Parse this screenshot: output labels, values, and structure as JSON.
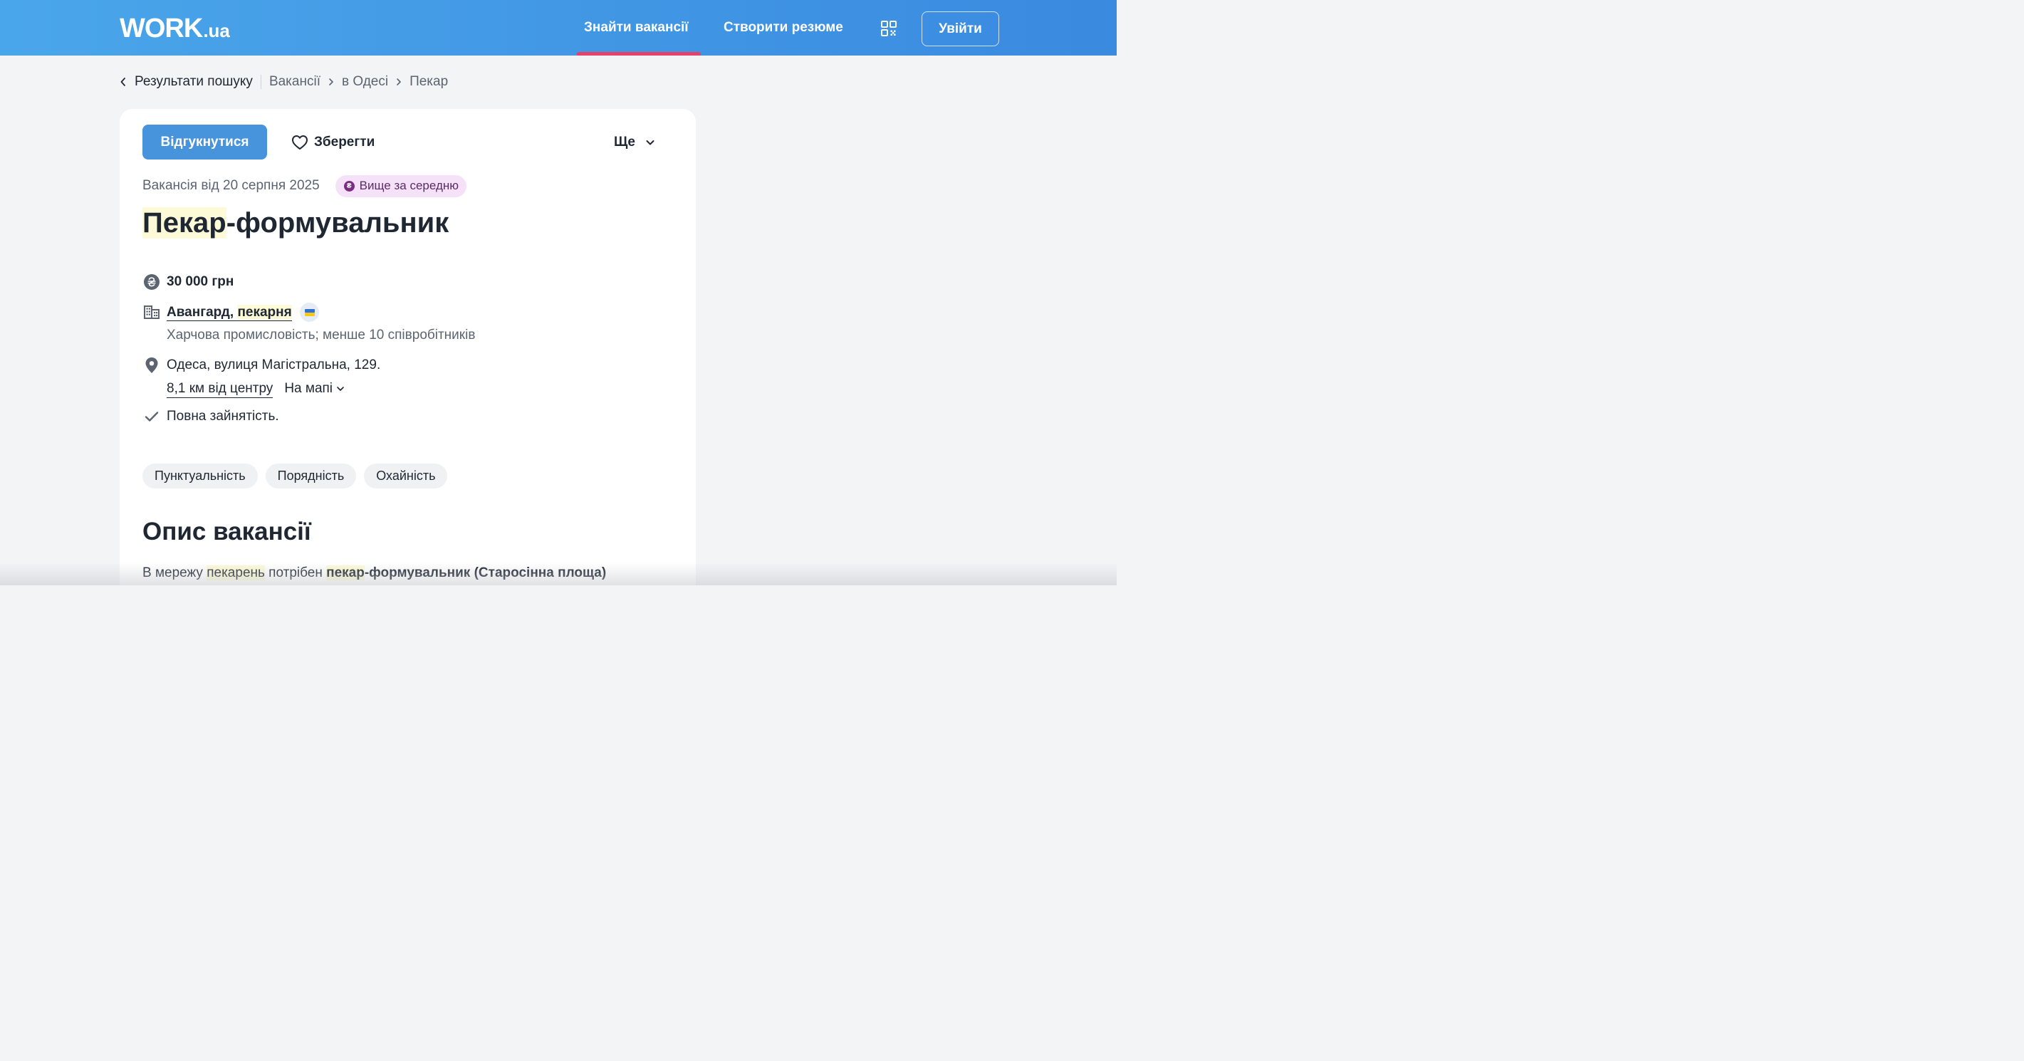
{
  "header": {
    "logo_main": "WORK",
    "logo_suffix": ".ua",
    "nav_find": "Знайти вакансії",
    "nav_resume": "Створити резюме",
    "login": "Увійти",
    "accent_color": "#e4416b"
  },
  "breadcrumb": {
    "back": "Результати пошуку",
    "items": [
      "Вакансії",
      "в Одесі",
      "Пекар"
    ]
  },
  "vacancy": {
    "apply": "Відгукнутися",
    "save": "Зберегти",
    "more": "Ще",
    "date": "Вакансія від 20 серпня 2025",
    "badge": "Вище за середню",
    "badge_symbol": "₴",
    "title_highlight": "Пекар",
    "title_rest": "-формувальник",
    "salary": "30 000 грн",
    "company_part1": "Авангард, ",
    "company_part2": "пекарня",
    "company_info": "Харчова промисловість; менше 10 співробітників",
    "address": "Одеса, вулиця Магістральна, 129.",
    "distance": "8,1 км від центру",
    "map": "На мапі",
    "employment": "Повна зайнятість.",
    "tags": [
      "Пунктуальність",
      "Порядність",
      "Охайність"
    ],
    "section_title": "Опис вакансії",
    "desc_1": "В мережу ",
    "desc_2": "пекарень",
    "desc_3": " потрібен ",
    "desc_4": "пекар",
    "desc_5": "-формувальник (Старосінна площа)"
  },
  "colors": {
    "header_start": "#4aa6ea",
    "header_end": "#3a8ae0",
    "primary_button": "#4793dc",
    "badge_bg": "#f5e2f8",
    "highlight": "#fdfad8"
  },
  "icons": {
    "back": "chevron-left-icon",
    "crumb_separator": "chevron-right-icon",
    "save": "heart-icon",
    "more": "chevron-down-icon",
    "qr": "qr-code-icon",
    "salary": "hryvnia-coin-icon",
    "company": "building-icon",
    "flag": "ukraine-flag-icon",
    "location": "map-pin-icon",
    "employment": "check-icon"
  }
}
